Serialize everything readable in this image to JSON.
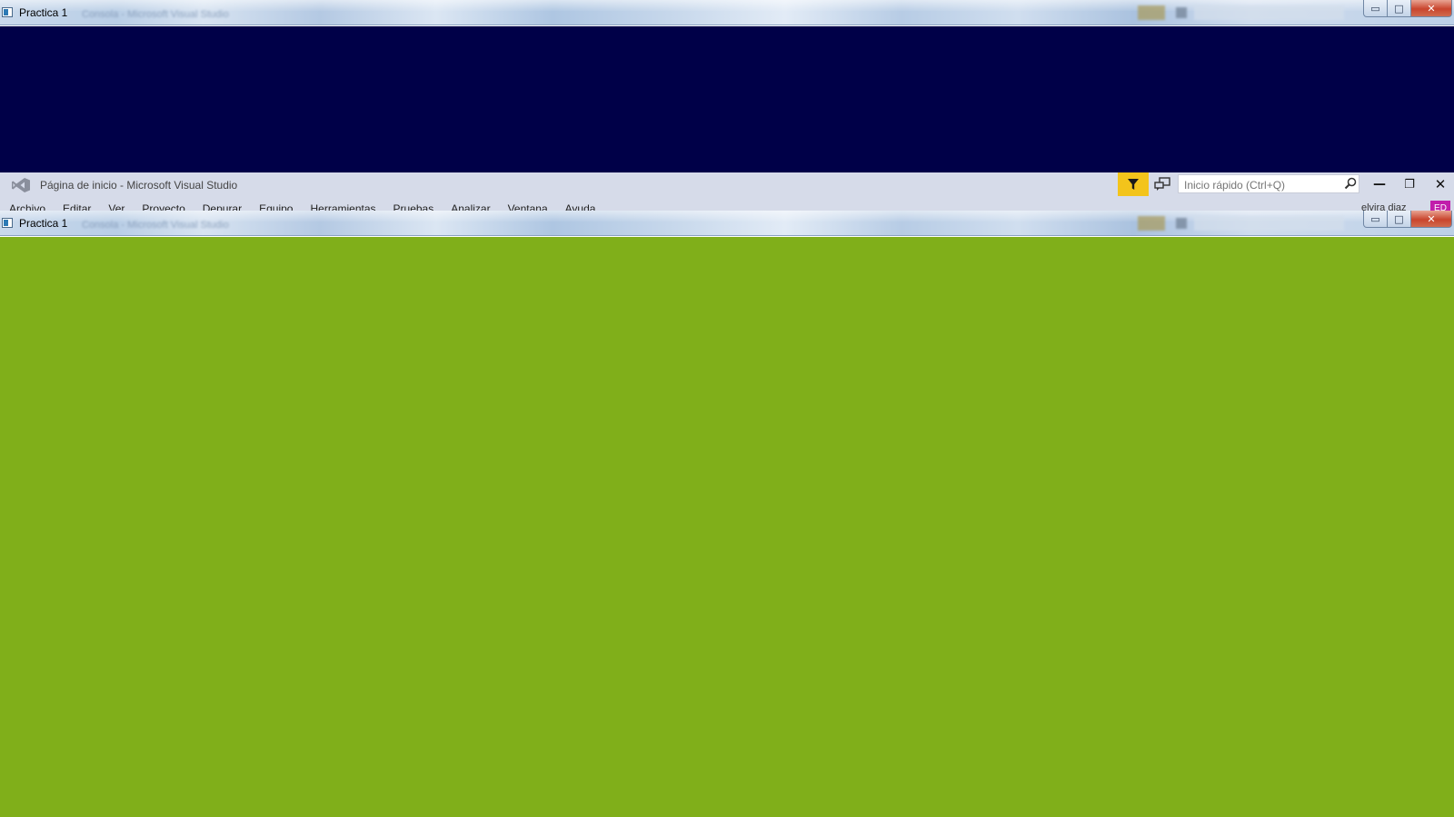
{
  "colors": {
    "navy_console_bg": "#000048",
    "green_console_bg": "#80af1a",
    "vs_header_bg": "#d6dbe9",
    "filter_accent": "#f3c41b",
    "avatar_bg": "#c11dab"
  },
  "console_top": {
    "title": "Practica 1",
    "background_title": "Consola - Microsoft Visual Studio",
    "icons": {
      "app": "console-app-icon",
      "minimize": "minimize-icon",
      "maximize": "maximize-icon",
      "close": "close-icon"
    },
    "buttons": {
      "minimize": "▭",
      "maximize": "□",
      "close": "✕"
    }
  },
  "vs_window": {
    "title": "Página de inicio - Microsoft Visual Studio",
    "search_placeholder": "Inicio rápido (Ctrl+Q)",
    "menu": [
      "Archivo",
      "Editar",
      "Ver",
      "Proyecto",
      "Depurar",
      "Equipo",
      "Herramientas",
      "Pruebas",
      "Analizar",
      "Ventana",
      "Ayuda"
    ],
    "user_name": "elvira diaz",
    "user_initials": "ED",
    "icons": {
      "logo": "visual-studio-logo-icon",
      "filter": "filter-icon",
      "feedback": "feedback-icon",
      "search": "search-icon"
    },
    "controls": {
      "minimize": "—",
      "restore": "❐",
      "close": "✕"
    }
  },
  "console_bottom": {
    "title": "Practica 1",
    "background_title": "Consola - Microsoft Visual Studio",
    "buttons": {
      "minimize": "▭",
      "maximize": "□",
      "close": "✕"
    }
  }
}
